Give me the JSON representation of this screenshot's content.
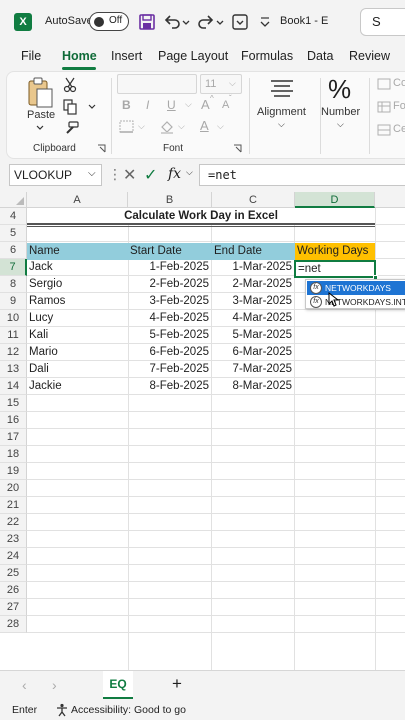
{
  "titlebar": {
    "app_letter": "X",
    "autosave_label": "AutoSave",
    "autosave_state": "Off",
    "book_title": "Book1 - E",
    "search_letter": "S"
  },
  "menu": {
    "items": [
      "File",
      "Home",
      "Insert",
      "Page Layout",
      "Formulas",
      "Data",
      "Review"
    ],
    "active": "Home"
  },
  "ribbon": {
    "paste_label": "Paste",
    "clipboard_label": "Clipboard",
    "font_label": "Font",
    "font_size": "11",
    "alignment_label": "Alignment",
    "number_label": "Number",
    "number_symbol": "%",
    "bold": "B",
    "italic": "I",
    "underline": "U",
    "grow_font": "A",
    "shrink_font": "A",
    "font_color": "A",
    "styles_items": [
      "Co",
      "Fo",
      "Ce"
    ]
  },
  "formula_bar": {
    "name_box": "VLOOKUP",
    "fx": "fx",
    "formula": "=net"
  },
  "grid": {
    "columns": [
      "A",
      "B",
      "C",
      "D"
    ],
    "selected_column": "D",
    "rows": [
      "4",
      "5",
      "6",
      "7",
      "8",
      "9",
      "10",
      "11",
      "12",
      "13",
      "14",
      "15",
      "16",
      "17",
      "18",
      "19",
      "20",
      "21",
      "22",
      "23",
      "24",
      "25",
      "26",
      "27",
      "28"
    ],
    "selected_row": "7",
    "sheet_title": "Calculate Work Day in Excel",
    "headers": [
      "Name",
      "Start Date",
      "End Date",
      "Working Days"
    ],
    "header_colors": {
      "blue": "#92cddc",
      "gold": "#ffc000"
    },
    "data": [
      {
        "name": "Jack",
        "start": "1-Feb-2025",
        "end": "1-Mar-2025"
      },
      {
        "name": "Sergio",
        "start": "2-Feb-2025",
        "end": "2-Mar-2025"
      },
      {
        "name": "Ramos",
        "start": "3-Feb-2025",
        "end": "3-Mar-2025"
      },
      {
        "name": "Lucy",
        "start": "4-Feb-2025",
        "end": "4-Mar-2025"
      },
      {
        "name": "Kali",
        "start": "5-Feb-2025",
        "end": "5-Mar-2025"
      },
      {
        "name": "Mario",
        "start": "6-Feb-2025",
        "end": "6-Mar-2025"
      },
      {
        "name": "Dali",
        "start": "7-Feb-2025",
        "end": "7-Mar-2025"
      },
      {
        "name": "Jackie",
        "start": "8-Feb-2025",
        "end": "8-Mar-2025"
      }
    ],
    "active_cell_value": "=net"
  },
  "autocomplete": {
    "items": [
      "NETWORKDAYS",
      "NETWORKDAYS.INTL"
    ]
  },
  "sheets": {
    "active": "EQ",
    "add": "+"
  },
  "status": {
    "mode": "Enter",
    "accessibility": "Accessibility: Good to go"
  },
  "colors": {
    "accent": "#107c41",
    "highlight": "#1e74d3"
  }
}
